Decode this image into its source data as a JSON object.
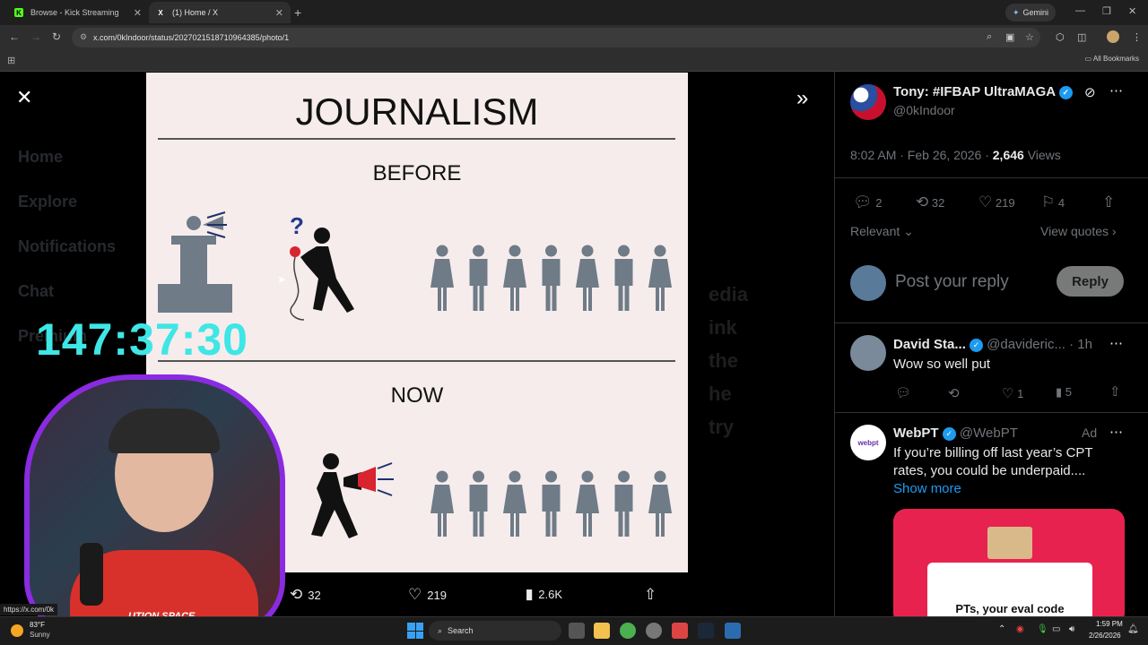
{
  "browser": {
    "tabs": [
      {
        "title": "Browse - Kick Streaming",
        "favicon": "K",
        "fav_color": "#53fc18",
        "active": false
      },
      {
        "title": "(1) Home / X",
        "favicon": "X",
        "fav_color": "#ffffff",
        "active": true
      }
    ],
    "new_tab": "+",
    "gemini_label": "Gemini",
    "url": "x.com/0kIndoor/status/2027021518710964385/photo/1",
    "bookmarks_label": "All Bookmarks"
  },
  "photo": {
    "title": "JOURNALISM",
    "before_label": "BEFORE",
    "now_label": "NOW",
    "question_mark": "?"
  },
  "overlay": {
    "timer": "147:37:30",
    "stream_shirt_text": "UTION SPACE",
    "status_url": "https://x.com/0k"
  },
  "photo_actions": {
    "retweets": "32",
    "likes": "219",
    "views": "2.6K"
  },
  "background_nav": [
    "Home",
    "Explore",
    "Notifications",
    "Chat",
    "Premium"
  ],
  "background_text": [
    "edia",
    "ink",
    "the",
    "he",
    "try"
  ],
  "tweet": {
    "author_name": "Tony: #IFBAP UltraMAGA",
    "author_handle": "@0kIndoor",
    "time": "8:02 AM · Feb 26, 2026 · ",
    "views_count": "2,646",
    "views_label": " Views",
    "replies": "2",
    "retweets": "32",
    "likes": "219",
    "bookmarks": "4",
    "sort_label": "Relevant",
    "view_quotes": "View quotes",
    "reply_placeholder": "Post your reply",
    "reply_button": "Reply"
  },
  "replies": [
    {
      "name": "David Sta...",
      "handle": "@davideric...",
      "time": "· 1h",
      "text": "Wow so well put",
      "likes": "1",
      "views": "5"
    }
  ],
  "ad": {
    "name": "WebPT",
    "handle": "@WebPT",
    "ad_label": "Ad",
    "avatar_text": "webpt",
    "text_line1": "If you’re billing off last year’s CPT",
    "text_line2": "rates, you could be underpaid....",
    "show_more": "Show more",
    "card_text": "PTs, your eval code",
    "card_color": "#e8224f"
  },
  "taskbar": {
    "temp": "83°F",
    "weather": "Sunny",
    "search_placeholder": "Search",
    "time": "1:59 PM",
    "date": "2/26/2026"
  },
  "colors": {
    "accent_blue": "#1d9bf0",
    "timer_cyan": "#3fe6e6",
    "cam_border": "#8a2be2",
    "figure_gray": "#6f7b87"
  }
}
